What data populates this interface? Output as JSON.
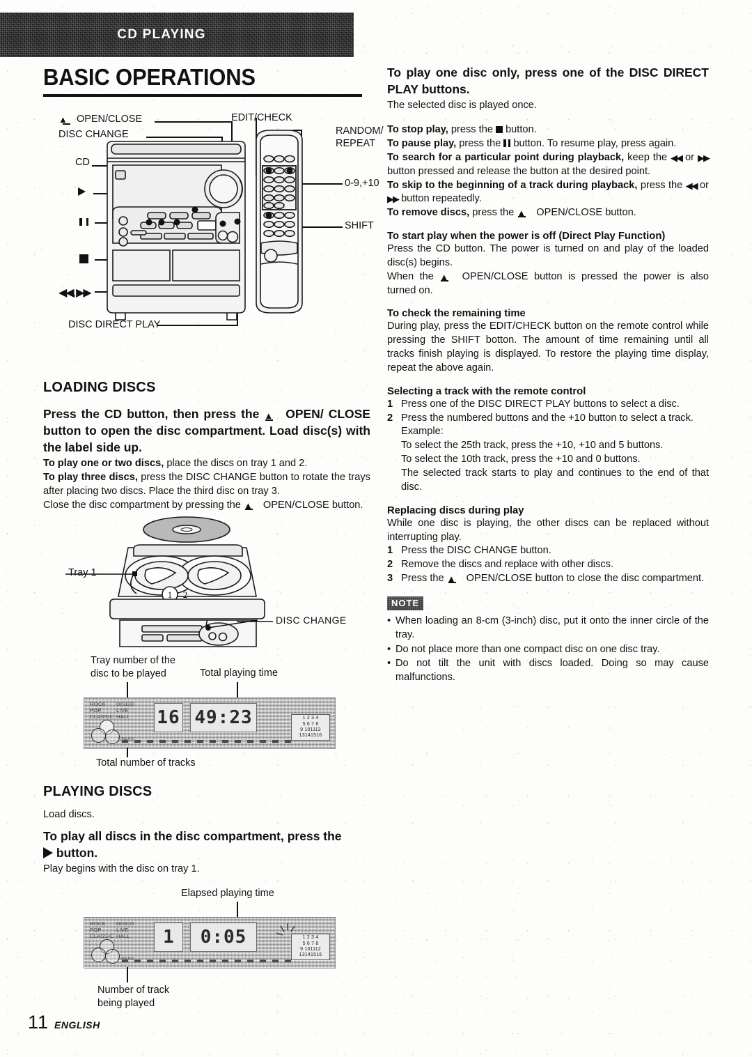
{
  "header": {
    "band_title": "CD PLAYING"
  },
  "page_title": "BASIC OPERATIONS",
  "figure1": {
    "labels": {
      "open_close": "OPEN/CLOSE",
      "disc_change": "DISC CHANGE",
      "cd": "CD",
      "play": "play-triangle",
      "pause": "pause-bars",
      "stop": "stop-square",
      "skip": "skip-arrows",
      "disc_direct_play": "DISC DIRECT PLAY",
      "edit_check": "EDIT/CHECK",
      "random_repeat": "RANDOM/\nREPEAT",
      "random_repeat_l1": "RANDOM/",
      "random_repeat_l2": "REPEAT",
      "numbers": "0-9,+10",
      "shift": "SHIFT"
    }
  },
  "loading": {
    "heading": "LOADING DISCS",
    "lead_1": "Press the CD button, then press the",
    "lead_2": "OPEN/",
    "lead_3": "CLOSE button to open the disc compartment. Load disc(s) with the label side up.",
    "line1_b": "To play one or two discs,",
    "line1_t": "place the discs on tray 1 and 2.",
    "line2_b": "To play three discs,",
    "line2_t": "press the DISC CHANGE button to rotate the trays after placing two discs.  Place the third disc on tray 3.",
    "line3_a": "Close the disc compartment by pressing the",
    "line3_b": "OPEN/CLOSE button."
  },
  "figure2": {
    "tray1_label": "Tray 1",
    "disc_change_label": "DISC CHANGE",
    "tray_num_1": "1",
    "tray_num_2": "2",
    "callout_tray_number": "Tray number of the\ndisc to be played",
    "callout_tray_number_l1": "Tray number of the",
    "callout_tray_number_l2": "disc to be played",
    "callout_total_time": "Total playing time",
    "callout_total_tracks": "Total number of tracks"
  },
  "lcd1": {
    "eq_left": [
      "ROCK",
      "POP",
      "CLASSIC"
    ],
    "eq_right": [
      "DISCO",
      "LIVE",
      "HALL"
    ],
    "tbass": "T-BASS",
    "tray_value": "16",
    "time_value": "49:23",
    "track_grid": [
      "1",
      "2",
      "3",
      "4",
      "5",
      "6",
      "7",
      "8",
      "9",
      "10",
      "11",
      "12",
      "13",
      "14",
      "15",
      "16"
    ]
  },
  "playing": {
    "heading": "PLAYING DISCS",
    "intro": "Load discs.",
    "lead_1": "To play all discs in the disc compartment, press the",
    "lead_2": "button.",
    "body": "Play begins with the disc on tray 1."
  },
  "lcd2": {
    "eq_left": [
      "ROCK",
      "POP",
      "CLASSIC"
    ],
    "eq_right": [
      "DISCO",
      "LIVE",
      "HALL"
    ],
    "tbass": "T-BASS",
    "track_value": "1",
    "time_value": "0:05",
    "track_grid": [
      "1",
      "2",
      "3",
      "4",
      "5",
      "6",
      "7",
      "8",
      "9",
      "10",
      "11",
      "12",
      "13",
      "14",
      "15",
      "16"
    ],
    "callout_elapsed": "Elapsed playing time",
    "callout_track_l1": "Number of track",
    "callout_track_l2": "being played"
  },
  "right": {
    "disc_direct": {
      "lead": "To play one disc only, press one of the DISC DIRECT PLAY buttons.",
      "body": "The selected disc is played once."
    },
    "controls": {
      "stop_b": "To stop play,",
      "stop_t1": "press the",
      "stop_t2": "button.",
      "pause_b": "To pause play,",
      "pause_t1": "press the",
      "pause_t2": "button. To resume play, press again.",
      "search_b": "To search for a particular point during playback,",
      "search_t1": "keep the",
      "search_or": "or",
      "search_t2": "button pressed and release the button at the desired point.",
      "skip_b": "To skip to the beginning of a track during playback,",
      "skip_t1": "press the",
      "skip_or": "or",
      "skip_t2": "button repeatedly.",
      "remove_b": "To remove discs,",
      "remove_t1": "press the",
      "remove_t2": "OPEN/CLOSE button."
    },
    "direct_play": {
      "heading": "To start play when the power is off (Direct Play Function)",
      "p1": "Press the CD button.  The power is turned on and play of the loaded disc(s) begins.",
      "p2a": "When  the",
      "p2b": "OPEN/CLOSE button is pressed the power is also turned on."
    },
    "remaining": {
      "heading": "To check the remaining time",
      "body": "During play, press the EDIT/CHECK button on the remote control while pressing the SHIFT botton. The amount of time remaining until all tracks finish playing is displayed. To restore the playing time display, repeat the above again."
    },
    "select_track": {
      "heading": "Selecting a track with the remote control",
      "item1_n": "1",
      "item1_t": "Press one of the DISC DIRECT PLAY buttons to select a disc.",
      "item2_n": "2",
      "item2_t": "Press the numbered buttons and the +10 button to select a track.",
      "example_label": "Example:",
      "example_1": "To select the 25th track, press the +10, +10 and 5 buttons.",
      "example_2": "To select the 10th track, press the +10 and 0 buttons.",
      "example_3": "The selected track starts to play and continues to the end of that disc."
    },
    "replacing": {
      "heading": "Replacing discs during play",
      "intro": "While one disc is playing, the other discs can be replaced without interrupting  play.",
      "item1_n": "1",
      "item1_t": "Press the DISC CHANGE button.",
      "item2_n": "2",
      "item2_t": "Remove the discs and replace with other discs.",
      "item3_n": "3",
      "item3_t1": "Press  the",
      "item3_t2": "OPEN/CLOSE  button  to  close  the  disc compartment."
    },
    "note": {
      "badge": "NOTE",
      "items": [
        "When loading an 8-cm (3-inch) disc, put it onto the inner circle of the tray.",
        "Do not place more than one compact disc on one disc tray.",
        "Do not tilt the unit with discs loaded.  Doing so may cause malfunctions."
      ]
    }
  },
  "footer": {
    "page_number": "11",
    "language": "ENGLISH"
  }
}
